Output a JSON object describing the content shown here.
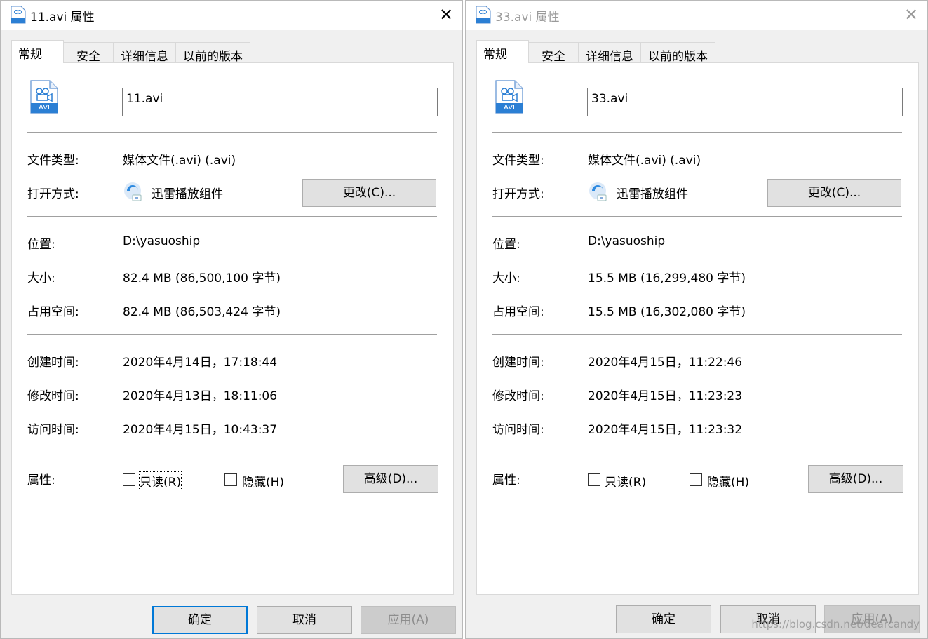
{
  "windows": [
    {
      "title": "11.avi 属性",
      "tabs": [
        "常规",
        "安全",
        "详细信息",
        "以前的版本"
      ],
      "filename": "11.avi",
      "file_icon_label": "AVI",
      "type_label": "文件类型:",
      "type_value": "媒体文件(.avi) (.avi)",
      "opens_label": "打开方式:",
      "opens_value": "迅雷播放组件",
      "change_button": "更改(C)...",
      "location_label": "位置:",
      "location_value": "D:\\yasuoship",
      "size_label": "大小:",
      "size_value": "82.4 MB (86,500,100 字节)",
      "disk_label": "占用空间:",
      "disk_value": "82.4 MB (86,503,424 字节)",
      "created_label": "创建时间:",
      "created_value": "2020年4月14日，17:18:44",
      "modified_label": "修改时间:",
      "modified_value": "2020年4月13日，18:11:06",
      "accessed_label": "访问时间:",
      "accessed_value": "2020年4月15日，10:43:37",
      "attrs_label": "属性:",
      "readonly_label": "只读(R)",
      "hidden_label": "隐藏(H)",
      "advanced_button": "高级(D)...",
      "ok_button": "确定",
      "cancel_button": "取消",
      "apply_button": "应用(A)"
    },
    {
      "title": "33.avi 属性",
      "tabs": [
        "常规",
        "安全",
        "详细信息",
        "以前的版本"
      ],
      "filename": "33.avi",
      "file_icon_label": "AVI",
      "type_label": "文件类型:",
      "type_value": "媒体文件(.avi) (.avi)",
      "opens_label": "打开方式:",
      "opens_value": "迅雷播放组件",
      "change_button": "更改(C)...",
      "location_label": "位置:",
      "location_value": "D:\\yasuoship",
      "size_label": "大小:",
      "size_value": "15.5 MB (16,299,480 字节)",
      "disk_label": "占用空间:",
      "disk_value": "15.5 MB (16,302,080 字节)",
      "created_label": "创建时间:",
      "created_value": "2020年4月15日，11:22:46",
      "modified_label": "修改时间:",
      "modified_value": "2020年4月15日，11:23:23",
      "accessed_label": "访问时间:",
      "accessed_value": "2020年4月15日，11:23:32",
      "attrs_label": "属性:",
      "readonly_label": "只读(R)",
      "hidden_label": "隐藏(H)",
      "advanced_button": "高级(D)...",
      "ok_button": "确定",
      "cancel_button": "取消",
      "apply_button": "应用(A)"
    }
  ],
  "close_glyph": "✕",
  "watermark": "https://blog.csdn.net/dearcandy",
  "colors": {
    "accent": "#0078d7",
    "button_bg": "#e1e1e1",
    "dialog_bg": "#f0f0f0",
    "file_icon_blue": "#2b7fd4"
  }
}
